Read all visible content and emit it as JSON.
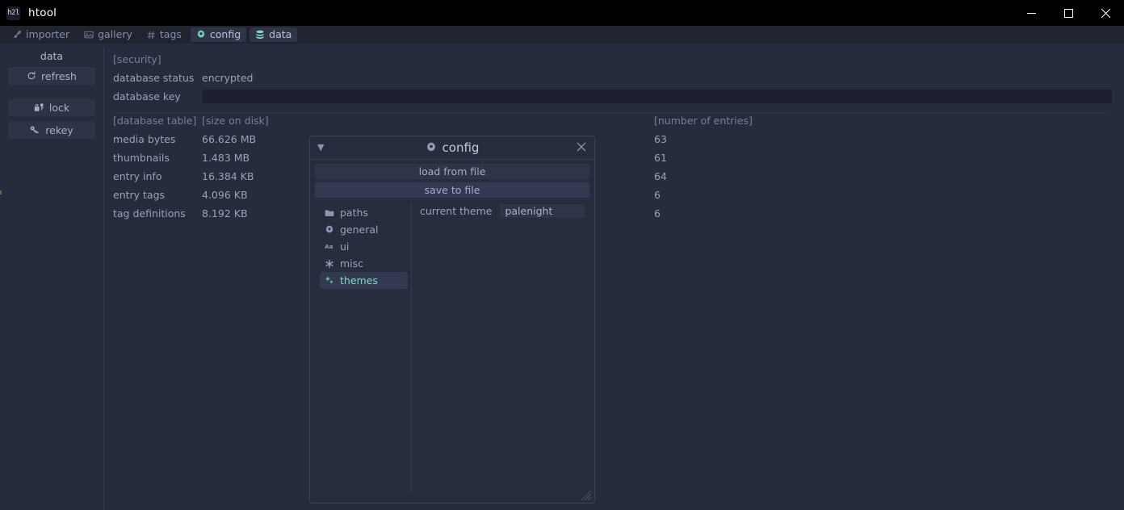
{
  "window": {
    "icon_text": "h2l",
    "title": "htool",
    "controls": {
      "minimize": "minimize",
      "maximize": "maximize",
      "close": "close"
    }
  },
  "menubar": {
    "items": [
      {
        "label": "importer",
        "icon": "brush-icon",
        "active": false
      },
      {
        "label": "gallery",
        "icon": "image-icon",
        "active": false
      },
      {
        "label": "tags",
        "icon": "hash-icon",
        "active": false
      },
      {
        "label": "config",
        "icon": "gear-icon",
        "active": true
      },
      {
        "label": "data",
        "icon": "database-icon",
        "active": true
      }
    ]
  },
  "sidebar": {
    "title": "data",
    "buttons": [
      {
        "label": "refresh",
        "icon": "refresh-icon"
      },
      {
        "label": "lock",
        "icon": "lock-icon"
      },
      {
        "label": "rekey",
        "icon": "key-icon"
      }
    ]
  },
  "main": {
    "security": {
      "heading": "[security]",
      "status_label": "database status",
      "status_value": "encrypted",
      "key_label": "database key",
      "key_value": "",
      "key_placeholder": ""
    },
    "table": {
      "headers": {
        "name": "[database table]",
        "size": "[size on disk]",
        "count": "[number of entries]"
      },
      "rows": [
        {
          "name": "media bytes",
          "size": "66.626 MB",
          "count": "63"
        },
        {
          "name": "thumbnails",
          "size": "1.483 MB",
          "count": "61"
        },
        {
          "name": "entry info",
          "size": "16.384 KB",
          "count": "64"
        },
        {
          "name": "entry tags",
          "size": "4.096 KB",
          "count": "6"
        },
        {
          "name": "tag definitions",
          "size": "8.192 KB",
          "count": "6"
        }
      ]
    }
  },
  "dialog": {
    "title": "config",
    "title_icon": "gear-icon",
    "collapse_icon": "triangle-down-icon",
    "close_icon": "close-icon",
    "load_button": "load from file",
    "save_button": "save to file",
    "nav": [
      {
        "label": "paths",
        "icon": "folder-icon",
        "selected": false
      },
      {
        "label": "general",
        "icon": "gear-icon",
        "selected": false
      },
      {
        "label": "ui",
        "icon": "font-icon",
        "selected": false
      },
      {
        "label": "misc",
        "icon": "asterisk-icon",
        "selected": false
      },
      {
        "label": "themes",
        "icon": "sparkle-icon",
        "selected": true
      }
    ],
    "pane": {
      "theme_label": "current theme",
      "theme_value": "palenight"
    }
  },
  "colors": {
    "background": "#262b3d",
    "titlebar": "#000000",
    "menubar": "#20242f",
    "accent": "#7fd8c8",
    "text": "#9aa1ba",
    "muted": "#777f9c",
    "panel": "#2f3548",
    "edge_marker": "#6b6a33"
  }
}
